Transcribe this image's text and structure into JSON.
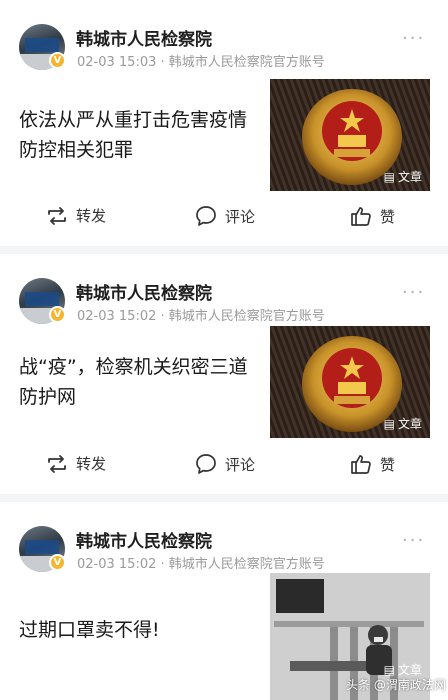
{
  "feed": [
    {
      "author": "韩城市人民检察院",
      "verified_badge": "V",
      "time": "02-03 15:03",
      "source": "韩城市人民检察院官方账号",
      "title_lines": [
        "依法从严从重打击危害疫情",
        "防控相关犯罪"
      ],
      "thumb_tag": "文章",
      "thumb_icon": "document-icon",
      "actions": {
        "repost": "转发",
        "comment": "评论",
        "like": "赞"
      }
    },
    {
      "author": "韩城市人民检察院",
      "verified_badge": "V",
      "time": "02-03 15:02",
      "source": "韩城市人民检察院官方账号",
      "title_lines": [
        "战“疫”，检察机关织密三道",
        "防护网"
      ],
      "thumb_tag": "文章",
      "thumb_icon": "document-icon",
      "actions": {
        "repost": "转发",
        "comment": "评论",
        "like": "赞"
      }
    },
    {
      "author": "韩城市人民检察院",
      "verified_badge": "V",
      "time": "02-03 15:02",
      "source": "韩城市人民检察院官方账号",
      "title_lines": [
        "过期口罩卖不得!"
      ],
      "thumb_tag": "文章",
      "thumb_icon": "document-icon"
    }
  ],
  "meta_separator": "·",
  "more_glyph": "···",
  "watermark": "头条 @渭南政法网",
  "colors": {
    "badge": "#f5b52e",
    "meta": "#9a9a9a",
    "background": "#f4f5f6"
  }
}
